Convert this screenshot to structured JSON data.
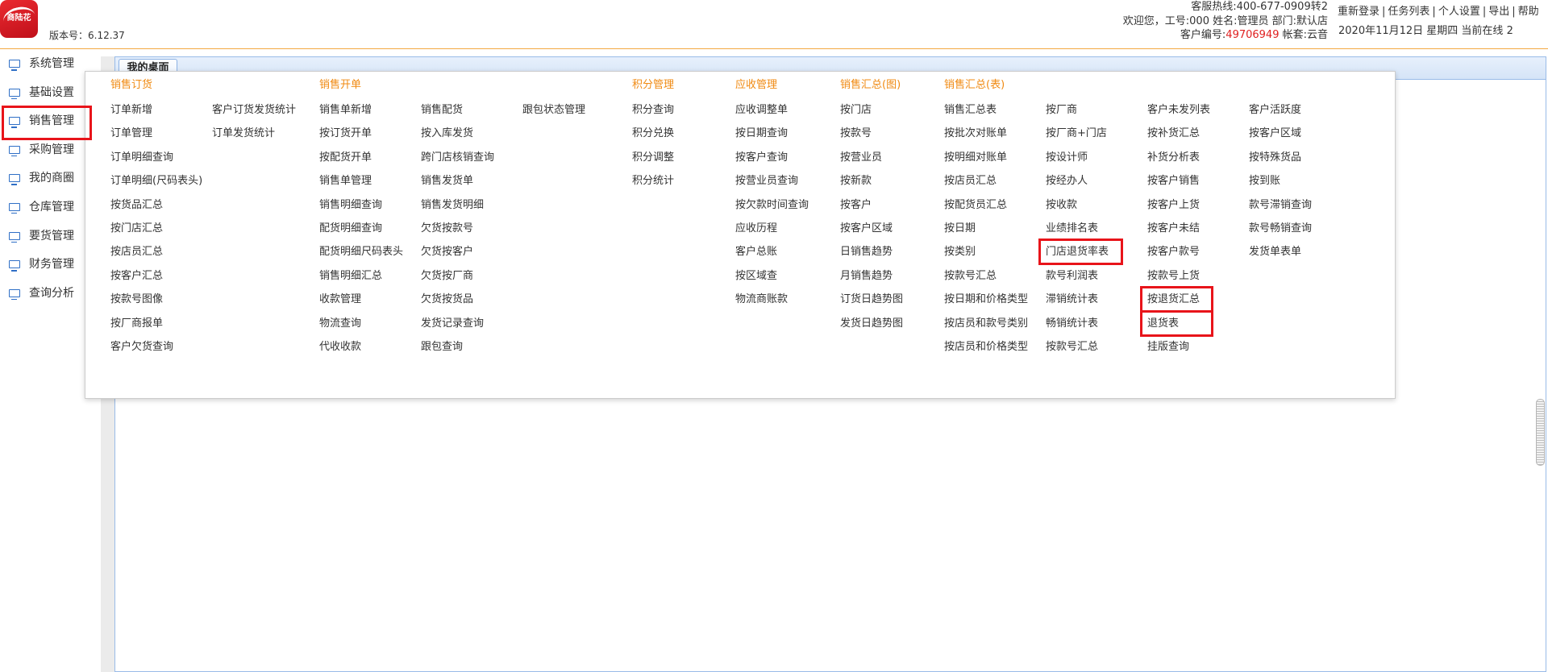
{
  "app": {
    "logo_text": "商陆花",
    "version": "版本号：6.12.37"
  },
  "header": {
    "hotline": "客服热线:400-677-0909转2",
    "welcome": "欢迎您，工号:000 姓名:管理员 部门:默认店",
    "customer_label": "客户编号:",
    "customer_no": "49706949",
    "account_set": "帐套:云音",
    "links": [
      "重新登录",
      "任务列表",
      "个人设置",
      "导出",
      "帮助"
    ],
    "separator": "|",
    "date_status": "2020年11月12日 星期四 当前在线 2"
  },
  "sidebar": {
    "item_icon": "monitor-icon",
    "items": [
      {
        "label": "系统管理"
      },
      {
        "label": "基础设置"
      },
      {
        "label": "销售管理",
        "highlight": true
      },
      {
        "label": "采购管理"
      },
      {
        "label": "我的商圈"
      },
      {
        "label": "仓库管理"
      },
      {
        "label": "要货管理"
      },
      {
        "label": "财务管理"
      },
      {
        "label": "查询分析"
      }
    ]
  },
  "tabs": [
    {
      "label": "我的桌面",
      "active": true
    }
  ],
  "sales_menu": {
    "columns": [
      {
        "heading": "销售订货",
        "items": [
          "订单新增",
          "订单管理",
          "订单明细查询",
          "订单明细(尺码表头)",
          "按货品汇总",
          "按门店汇总",
          "按店员汇总",
          "按客户汇总",
          "按款号图像",
          "按厂商报单",
          "客户欠货查询"
        ]
      },
      {
        "items": [
          "客户订货发货统计",
          "订单发货统计"
        ]
      },
      {
        "heading": "销售开单",
        "items": [
          "销售单新增",
          "按订货开单",
          "按配货开单",
          "销售单管理",
          "销售明细查询",
          "配货明细查询",
          "配货明细尺码表头",
          "销售明细汇总",
          "收款管理",
          "物流查询",
          "代收收款"
        ]
      },
      {
        "items": [
          "销售配货",
          "按入库发货",
          "跨门店核销查询",
          "销售发货单",
          "销售发货明细",
          "欠货按款号",
          "欠货按客户",
          "欠货按厂商",
          "欠货按货品",
          "发货记录查询",
          "跟包查询"
        ]
      },
      {
        "items": [
          "跟包状态管理"
        ]
      },
      {
        "heading": "积分管理",
        "items": [
          "积分查询",
          "积分兑换",
          "积分调整",
          "积分统计"
        ]
      },
      {
        "heading": "应收管理",
        "items": [
          "应收调整单",
          "按日期查询",
          "按客户查询",
          "按营业员查询",
          "按欠款时间查询",
          "应收历程",
          "客户总账",
          "按区域查",
          "物流商账款"
        ]
      },
      {
        "heading": "销售汇总(图)",
        "items": [
          "按门店",
          "按款号",
          "按营业员",
          "按新款",
          "按客户",
          "按客户区域",
          "日销售趋势",
          "月销售趋势",
          "订货日趋势图",
          "发货日趋势图"
        ]
      },
      {
        "heading": "销售汇总(表)",
        "items": [
          "销售汇总表",
          "按批次对账单",
          "按明细对账单",
          "按店员汇总",
          "按配货员汇总",
          "按日期",
          "按类别",
          "按款号汇总",
          "按日期和价格类型",
          "按店员和款号类别",
          "按店员和价格类型"
        ]
      },
      {
        "items": [
          "按厂商",
          "按厂商+门店",
          "按设计师",
          "按经办人",
          "按收款",
          "业绩排名表",
          {
            "label": "门店退货率表",
            "highlight": true
          },
          "款号利润表",
          "滞销统计表",
          "畅销统计表",
          "按款号汇总"
        ]
      },
      {
        "items": [
          "客户未发列表",
          "按补货汇总",
          "补货分析表",
          "按客户销售",
          "按客户上货",
          "按客户未结",
          "按客户款号",
          "按款号上货",
          {
            "label": "按退货汇总",
            "highlight": true
          },
          {
            "label": "退货表",
            "highlight": true
          },
          "挂版查询"
        ]
      },
      {
        "items": [
          "客户活跃度",
          "按客户区域",
          "按特殊货品",
          "按到账",
          "款号滞销查询",
          "款号畅销查询",
          "发货单表单"
        ]
      }
    ]
  },
  "colors": {
    "header_line": "#f4a942",
    "menu_heading": "#f08a12",
    "customer_no": "#e02020",
    "highlight_box": "#e8141a",
    "sidebar_icon": "#2f6fc6",
    "panel_border": "#99bbe8"
  }
}
